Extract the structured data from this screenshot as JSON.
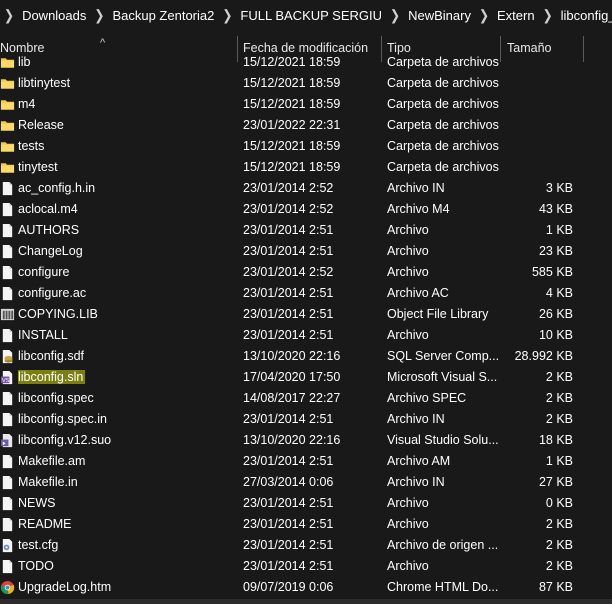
{
  "breadcrumb": [
    "Downloads",
    "Backup Zentoria2",
    "FULL BACKUP SERGIU",
    "NewBinary",
    "Extern",
    "libconfig_source"
  ],
  "columns": {
    "name": "Nombre",
    "date": "Fecha de modificación",
    "type": "Tipo",
    "size": "Tamaño"
  },
  "files": [
    {
      "name": "lib",
      "date": "15/12/2021 18:59",
      "type": "Carpeta de archivos",
      "size": "",
      "icon": "folder-icon"
    },
    {
      "name": "libtinytest",
      "date": "15/12/2021 18:59",
      "type": "Carpeta de archivos",
      "size": "",
      "icon": "folder-icon"
    },
    {
      "name": "m4",
      "date": "15/12/2021 18:59",
      "type": "Carpeta de archivos",
      "size": "",
      "icon": "folder-icon"
    },
    {
      "name": "Release",
      "date": "23/01/2022 22:31",
      "type": "Carpeta de archivos",
      "size": "",
      "icon": "folder-icon"
    },
    {
      "name": "tests",
      "date": "15/12/2021 18:59",
      "type": "Carpeta de archivos",
      "size": "",
      "icon": "folder-icon"
    },
    {
      "name": "tinytest",
      "date": "15/12/2021 18:59",
      "type": "Carpeta de archivos",
      "size": "",
      "icon": "folder-icon"
    },
    {
      "name": "ac_config.h.in",
      "date": "23/01/2014 2:52",
      "type": "Archivo IN",
      "size": "3 KB",
      "icon": "file-icon"
    },
    {
      "name": "aclocal.m4",
      "date": "23/01/2014 2:52",
      "type": "Archivo M4",
      "size": "43 KB",
      "icon": "file-icon"
    },
    {
      "name": "AUTHORS",
      "date": "23/01/2014 2:51",
      "type": "Archivo",
      "size": "1 KB",
      "icon": "file-icon"
    },
    {
      "name": "ChangeLog",
      "date": "23/01/2014 2:51",
      "type": "Archivo",
      "size": "23 KB",
      "icon": "file-icon"
    },
    {
      "name": "configure",
      "date": "23/01/2014 2:52",
      "type": "Archivo",
      "size": "585 KB",
      "icon": "file-icon"
    },
    {
      "name": "configure.ac",
      "date": "23/01/2014 2:51",
      "type": "Archivo AC",
      "size": "4 KB",
      "icon": "file-icon"
    },
    {
      "name": "COPYING.LIB",
      "date": "23/01/2014 2:51",
      "type": "Object File Library",
      "size": "26 KB",
      "icon": "library-file-icon"
    },
    {
      "name": "INSTALL",
      "date": "23/01/2014 2:51",
      "type": "Archivo",
      "size": "10 KB",
      "icon": "file-icon"
    },
    {
      "name": "libconfig.sdf",
      "date": "13/10/2020 22:16",
      "type": "SQL Server Comp...",
      "size": "28.992 KB",
      "icon": "database-file-icon"
    },
    {
      "name": "libconfig.sln",
      "date": "17/04/2020 17:50",
      "type": "Microsoft Visual S...",
      "size": "2 KB",
      "icon": "visual-studio-solution-icon",
      "highlight": true
    },
    {
      "name": "libconfig.spec",
      "date": "14/08/2017 22:27",
      "type": "Archivo SPEC",
      "size": "2 KB",
      "icon": "file-icon"
    },
    {
      "name": "libconfig.spec.in",
      "date": "23/01/2014 2:51",
      "type": "Archivo IN",
      "size": "2 KB",
      "icon": "file-icon"
    },
    {
      "name": "libconfig.v12.suo",
      "date": "13/10/2020 22:16",
      "type": "Visual Studio Solu...",
      "size": "18 KB",
      "icon": "visual-studio-options-icon"
    },
    {
      "name": "Makefile.am",
      "date": "23/01/2014 2:51",
      "type": "Archivo AM",
      "size": "1 KB",
      "icon": "file-icon"
    },
    {
      "name": "Makefile.in",
      "date": "27/03/2014 0:06",
      "type": "Archivo IN",
      "size": "27 KB",
      "icon": "file-icon"
    },
    {
      "name": "NEWS",
      "date": "23/01/2014 2:51",
      "type": "Archivo",
      "size": "0 KB",
      "icon": "file-icon"
    },
    {
      "name": "README",
      "date": "23/01/2014 2:51",
      "type": "Archivo",
      "size": "2 KB",
      "icon": "file-icon"
    },
    {
      "name": "test.cfg",
      "date": "23/01/2014 2:51",
      "type": "Archivo de origen ...",
      "size": "2 KB",
      "icon": "config-file-icon"
    },
    {
      "name": "TODO",
      "date": "23/01/2014 2:51",
      "type": "Archivo",
      "size": "2 KB",
      "icon": "file-icon"
    },
    {
      "name": "UpgradeLog.htm",
      "date": "09/07/2019 0:06",
      "type": "Chrome HTML Do...",
      "size": "87 KB",
      "icon": "chrome-document-icon"
    }
  ],
  "colors": {
    "background": "#191919",
    "highlight": "#7b7f12",
    "folder": "#f2c94c"
  }
}
